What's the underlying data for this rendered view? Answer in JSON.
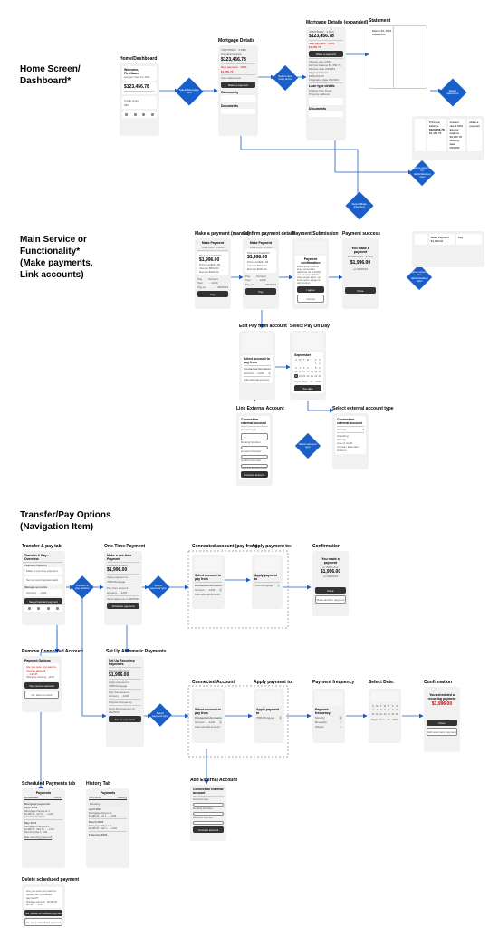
{
  "sections": {
    "home": "Home Screen/\nDashboard*",
    "main": "Main Service or\nFunctionality*\n(Make payments,\nLink accounts)",
    "transfer": "Transfer/Pay Options\n(Navigation Item)"
  },
  "labels": {
    "home_dashboard": "Home/Dashboard",
    "mortgage_details": "Mortgage Details",
    "mortgage_details_exp": "Mortgage Details (expanded)",
    "statement": "Statement",
    "make_payment": "Make a payment (manual)",
    "confirm_payment": "Confirm payment details",
    "payment_submission": "Payment Submission",
    "payment_success": "Payment success",
    "edit_pay_from": "Edit Pay from account",
    "select_pay_on": "Select Pay On Day",
    "link_external": "Link External Account",
    "select_ext_type": "Select external account type",
    "transfer_pay_tab": "Transfer & pay tab",
    "one_time": "One-Time Payment",
    "connected_account": "Connected account (pay from)",
    "apply_payment_to": "Apply payment to:",
    "confirmation": "Confirmation",
    "remove_connected": "Remove Connected Account",
    "setup_auto": "Set Up Automatic Payments",
    "connected_account2": "Connected Account",
    "apply_payment_to2": "Apply payment to:",
    "payment_frequency": "Payment frequency",
    "select_date": "Select Date:",
    "confirmation2": "Confirmation",
    "scheduled_tab": "Scheduled Payments tab",
    "history_tab": "History Tab",
    "add_external": "Add External Account",
    "delete_scheduled": "Delete scheduled payment"
  },
  "diamonds": {
    "view_mortgage": "Select Mortgage card",
    "view_more": "Select view more arrow",
    "view_statement": "Select statement",
    "goto_tablet": "Same screens for tablet/desktop view",
    "tablet_payments": "Same screens for tablet/desktop view",
    "make_payment": "Select Make Payment",
    "transfer_option": "Transfer & pay options",
    "select_ext": "Select external account",
    "pay_option": "Select payment type",
    "account_type": "Select account type"
  },
  "home_screen": {
    "greeting": "Welcome, FirstName",
    "sub": "Last log in Sept 1st, 2023",
    "balance": "$123,456.78",
    "credit_label": "Credit score",
    "credit_val": "680"
  },
  "mortgage": {
    "account": "7089765432 · 4.59%",
    "principal_label": "Principal balance",
    "principal": "$123,456.78",
    "next_label": "Next payment · 10/01",
    "next_amount": "$1,456.78",
    "view_statements": "View statements",
    "btn_pay": "Make a payment",
    "community": "Community",
    "docs": "Documents"
  },
  "mortgage_exp": {
    "interest_rate": "Interest rate  4.59%",
    "escrow": "Escrow balance  $3,456.78",
    "maturity": "Maturity date  09/2053",
    "original": "Original balance  $156,000.00",
    "origination": "Origination date  09/2023",
    "details_hdr": "Loan type details",
    "product": "Product  30yr Fixed",
    "property": "Property address"
  },
  "statement": {
    "title": "March 30, 2024 · Statement"
  },
  "payment": {
    "title": "Make Payment",
    "subtitle": "7086-xxxx · 4.59%",
    "due": "Payment Due 10/1",
    "amount": "$1,996.00",
    "principal": "Principal  $231.45",
    "interest": "Interest  $562.23",
    "escrow": "Escrow  $202.44",
    "pay_from": "Pay from",
    "pay_from_val": "Account ····1234",
    "pay_on": "Pay on",
    "pay_on_val": "08/25/23",
    "btn_pay": "Pay",
    "conf_title": "Payment confirmation",
    "conf_body": "Lorem ipsum dolor sit amet, consectetur adipiscing elit. Curabitur nec est neque. Nullam vitae congue lorem, vel luctus quam. Integer id velit sit amet.",
    "btn_agree": "I agree",
    "btn_cancel": "Cancel",
    "success_title": "You made a payment",
    "success_sub": "to 7086-xxxx · 4.59%",
    "success_date": "on 08/25/23",
    "btn_done": "Done"
  },
  "edit_from": {
    "title": "Select account to pay from",
    "connected": "Connected Accounts",
    "acc1": "Account ····1234",
    "add": "Add external account"
  },
  "calendar": {
    "month": "September",
    "day": "17",
    "year": "2023",
    "btn_set": "Set date"
  },
  "link_ext": {
    "title": "Connect an external account",
    "acc_type": "Account type",
    "routing": "Routing Number",
    "acc_num": "Account Number",
    "confirm_num": "Confirm Account",
    "disc": "Terms and disclosures apply",
    "btn": "Connect account"
  },
  "ext_type": {
    "title": "Connect an external account",
    "savings": "Savings",
    "checking": "Checking",
    "lob": "Line of credit",
    "other": "Annual / External / Custom"
  },
  "transfer_tab": {
    "title": "Transfer & Pay · Overview",
    "opts": "Payment Options",
    "opt1": "Make a one-time payment",
    "opt2": "Set up recurring/automatic",
    "manage": "Manage accounts",
    "acc": "Account ····1234",
    "sched_btn": "See scheduled payment"
  },
  "one_time": {
    "title": "Make a one-time Payment",
    "pay_amount": "Payment amount",
    "amount": "$1,996.00",
    "apply_to": "Apply payment to",
    "apply_val": "7086 Mortgage",
    "from": "Pay from account",
    "from_val": "Account ····1234",
    "send_on": "Send payment on",
    "send_val": "08/25/23",
    "btn_sched": "Schedule payment"
  },
  "connected": {
    "title": "Select account to pay from",
    "hdr": "Connected Accounts",
    "acc": "Account ····1234",
    "add": "Add external account"
  },
  "apply_to": {
    "title": "Apply payment to",
    "mort": "7086 Mortgage"
  },
  "confirm_one": {
    "title": "You made a payment",
    "to": "to 7086-xxxx",
    "amount": "$1,996.00",
    "on": "on 08/25/23",
    "btn": "Done",
    "btn2": "Make another payment"
  },
  "remove": {
    "title": "Payment Options",
    "warn": "Are you sure you want to remove account ····1234?",
    "mort": "(Mortgage checking…1234)",
    "btn_remove": "Yes, remove account",
    "btn_cancel": "No, take me back"
  },
  "auto": {
    "title": "Set Up Recurring Payments",
    "pay_amount": "Payment amount",
    "amount": "$1,996.00",
    "apply_to": "Apply payment to",
    "from": "Pay from account",
    "freq": "Payment frequency",
    "start": "Send first payment on",
    "btn": "Set up payments"
  },
  "freq": {
    "title": "Payment frequency",
    "m": "Monthly",
    "bw": "Bi-weekly",
    "w": "Weekly"
  },
  "confirm_auto": {
    "title": "You scheduled a\nrecurring payment",
    "amount": "$1,996.00",
    "btn": "Done",
    "btn2": "Edit automatic payment"
  },
  "scheduled": {
    "title": "Payments",
    "tab1": "Scheduled",
    "tab2": "History",
    "hdr1": "Mortgage payments",
    "apr": "April 2024",
    "p1": "Mortgage Payment 1",
    "p1_amt": "$1,996.00 · Apr 30 · ····1234",
    "p1_sub": "scheduled for April 1",
    "may": "May 2024",
    "p2": "Mortgage Payment 2",
    "p2_amt": "$1,996.00 · May 30 · ····1234",
    "p2_sub": "Recurring May 1, 2024",
    "link": "Edit recurring payment"
  },
  "history": {
    "title": "Payments",
    "tab1": "Scheduled",
    "tab2": "History",
    "pending": "Pending",
    "apr": "April 2024",
    "p1": "Mortgage Payment",
    "p1_amt": "$1,996.00 · Apr 1 · ····1234",
    "mar": "March 2024",
    "p2": "Mortgage Payment",
    "p2_amt": "$1,996.00 · Mar 1 · ····1234",
    "feb": "February 2024"
  },
  "delete": {
    "warn": "Are you sure you want to delete this scheduled payment?",
    "details": "Mortgage payment · $1,996.00 · Apr 30 · ····1234",
    "btn_del": "Yes, delete scheduled payment",
    "btn_cancel": "No, keep scheduled payment"
  },
  "add_ext": {
    "title": "Connect an external account",
    "acc_type": "Account type",
    "routing": "Routing Number",
    "acc_num": "Account Number",
    "btn": "Connect account"
  }
}
